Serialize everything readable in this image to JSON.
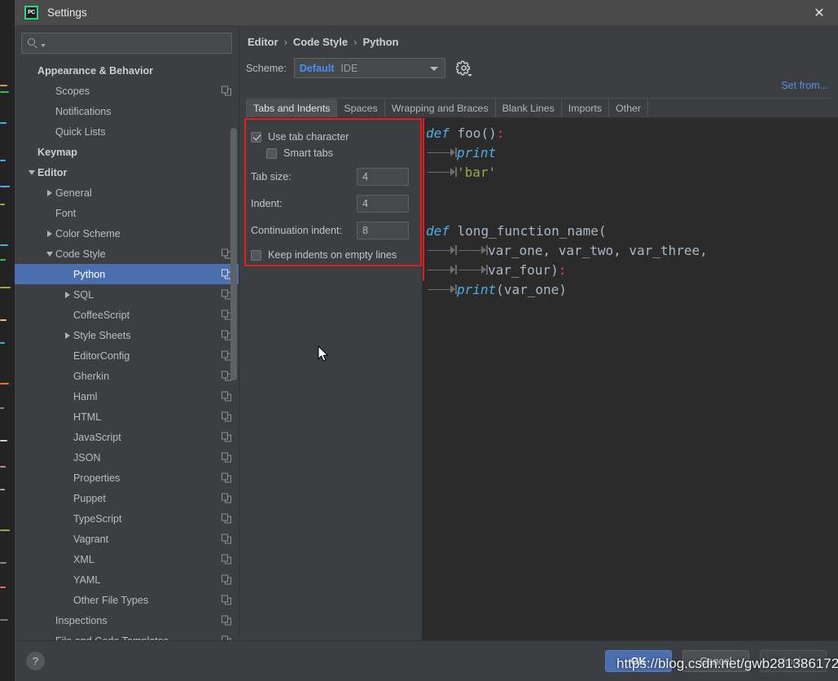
{
  "window": {
    "title": "Settings",
    "logo_text": "PC",
    "close_icon": "✕"
  },
  "sidebar": {
    "search": {
      "value": "",
      "placeholder": ""
    },
    "items": [
      {
        "label": "Appearance & Behavior",
        "indent": 0,
        "twisty": "none",
        "bold": true,
        "copy": false,
        "selected": false
      },
      {
        "label": "Scopes",
        "indent": 1,
        "twisty": "none",
        "bold": false,
        "copy": true,
        "selected": false
      },
      {
        "label": "Notifications",
        "indent": 1,
        "twisty": "none",
        "bold": false,
        "copy": false,
        "selected": false
      },
      {
        "label": "Quick Lists",
        "indent": 1,
        "twisty": "none",
        "bold": false,
        "copy": false,
        "selected": false
      },
      {
        "label": "Keymap",
        "indent": 0,
        "twisty": "none",
        "bold": true,
        "copy": false,
        "selected": false
      },
      {
        "label": "Editor",
        "indent": 0,
        "twisty": "down",
        "bold": true,
        "copy": false,
        "selected": false
      },
      {
        "label": "General",
        "indent": 1,
        "twisty": "right",
        "bold": false,
        "copy": false,
        "selected": false
      },
      {
        "label": "Font",
        "indent": 1,
        "twisty": "none",
        "bold": false,
        "copy": false,
        "selected": false
      },
      {
        "label": "Color Scheme",
        "indent": 1,
        "twisty": "right",
        "bold": false,
        "copy": false,
        "selected": false
      },
      {
        "label": "Code Style",
        "indent": 1,
        "twisty": "down",
        "bold": false,
        "copy": true,
        "selected": false
      },
      {
        "label": "Python",
        "indent": 2,
        "twisty": "none",
        "bold": false,
        "copy": true,
        "selected": true
      },
      {
        "label": "SQL",
        "indent": 2,
        "twisty": "right",
        "bold": false,
        "copy": true,
        "selected": false
      },
      {
        "label": "CoffeeScript",
        "indent": 2,
        "twisty": "none",
        "bold": false,
        "copy": true,
        "selected": false
      },
      {
        "label": "Style Sheets",
        "indent": 2,
        "twisty": "right",
        "bold": false,
        "copy": true,
        "selected": false
      },
      {
        "label": "EditorConfig",
        "indent": 2,
        "twisty": "none",
        "bold": false,
        "copy": true,
        "selected": false
      },
      {
        "label": "Gherkin",
        "indent": 2,
        "twisty": "none",
        "bold": false,
        "copy": true,
        "selected": false
      },
      {
        "label": "Haml",
        "indent": 2,
        "twisty": "none",
        "bold": false,
        "copy": true,
        "selected": false
      },
      {
        "label": "HTML",
        "indent": 2,
        "twisty": "none",
        "bold": false,
        "copy": true,
        "selected": false
      },
      {
        "label": "JavaScript",
        "indent": 2,
        "twisty": "none",
        "bold": false,
        "copy": true,
        "selected": false
      },
      {
        "label": "JSON",
        "indent": 2,
        "twisty": "none",
        "bold": false,
        "copy": true,
        "selected": false
      },
      {
        "label": "Properties",
        "indent": 2,
        "twisty": "none",
        "bold": false,
        "copy": true,
        "selected": false
      },
      {
        "label": "Puppet",
        "indent": 2,
        "twisty": "none",
        "bold": false,
        "copy": true,
        "selected": false
      },
      {
        "label": "TypeScript",
        "indent": 2,
        "twisty": "none",
        "bold": false,
        "copy": true,
        "selected": false
      },
      {
        "label": "Vagrant",
        "indent": 2,
        "twisty": "none",
        "bold": false,
        "copy": true,
        "selected": false
      },
      {
        "label": "XML",
        "indent": 2,
        "twisty": "none",
        "bold": false,
        "copy": true,
        "selected": false
      },
      {
        "label": "YAML",
        "indent": 2,
        "twisty": "none",
        "bold": false,
        "copy": true,
        "selected": false
      },
      {
        "label": "Other File Types",
        "indent": 2,
        "twisty": "none",
        "bold": false,
        "copy": true,
        "selected": false
      },
      {
        "label": "Inspections",
        "indent": 1,
        "twisty": "none",
        "bold": false,
        "copy": true,
        "selected": false
      },
      {
        "label": "File and Code Templates",
        "indent": 1,
        "twisty": "none",
        "bold": false,
        "copy": true,
        "selected": false
      }
    ]
  },
  "content": {
    "breadcrumb": [
      "Editor",
      "Code Style",
      "Python"
    ],
    "breadcrumb_separator": "›",
    "scheme": {
      "label": "Scheme:",
      "value": "Default",
      "scope": "IDE",
      "gear_icon": "gear-icon"
    },
    "set_from_link": "Set from...",
    "tabs": [
      {
        "label": "Tabs and Indents",
        "active": true
      },
      {
        "label": "Spaces",
        "active": false
      },
      {
        "label": "Wrapping and Braces",
        "active": false
      },
      {
        "label": "Blank Lines",
        "active": false
      },
      {
        "label": "Imports",
        "active": false
      },
      {
        "label": "Other",
        "active": false
      }
    ],
    "options": {
      "use_tab_character": {
        "label": "Use tab character",
        "checked": true
      },
      "smart_tabs": {
        "label": "Smart tabs",
        "checked": false
      },
      "tab_size": {
        "label": "Tab size:",
        "value": "4"
      },
      "indent": {
        "label": "Indent:",
        "value": "4"
      },
      "continuation_indent": {
        "label": "Continuation indent:",
        "value": "8"
      },
      "keep_indents_on_empty_lines": {
        "label": "Keep indents on empty lines",
        "checked": false
      }
    },
    "preview": {
      "lines": [
        {
          "tabs": 0,
          "tokens": [
            {
              "t": "def",
              "c": "kw"
            },
            {
              "t": " foo",
              "c": "plain"
            },
            {
              "t": "()",
              "c": "plain"
            },
            {
              "t": ":",
              "c": "punct"
            }
          ]
        },
        {
          "tabs": 1,
          "tokens": [
            {
              "t": "print",
              "c": "kw"
            }
          ]
        },
        {
          "tabs": 1,
          "tokens": [
            {
              "t": "'bar'",
              "c": "str"
            }
          ]
        },
        {
          "tabs": 0,
          "tokens": []
        },
        {
          "tabs": 0,
          "tokens": []
        },
        {
          "tabs": 0,
          "tokens": [
            {
              "t": "def",
              "c": "kw"
            },
            {
              "t": " long_function_name(",
              "c": "plain"
            }
          ]
        },
        {
          "tabs": 2,
          "tokens": [
            {
              "t": "var_one, var_two, var_three,",
              "c": "plain"
            }
          ]
        },
        {
          "tabs": 2,
          "tokens": [
            {
              "t": "var_four)",
              "c": "plain"
            },
            {
              "t": ":",
              "c": "punct"
            }
          ]
        },
        {
          "tabs": 1,
          "tokens": [
            {
              "t": "print",
              "c": "kw"
            },
            {
              "t": "(var_one)",
              "c": "plain"
            }
          ]
        }
      ]
    }
  },
  "footer": {
    "help_icon": "?",
    "ok_label": "OK",
    "cancel_label": "Cancel",
    "apply_label": "Apply"
  },
  "watermark": "https://blog.csdn.net/gwb281386172",
  "colors": {
    "accent": "#4b6eaf",
    "link": "#5b8fdd",
    "highlight_box": "#e02020",
    "scheme_value": "#4a8df8"
  }
}
